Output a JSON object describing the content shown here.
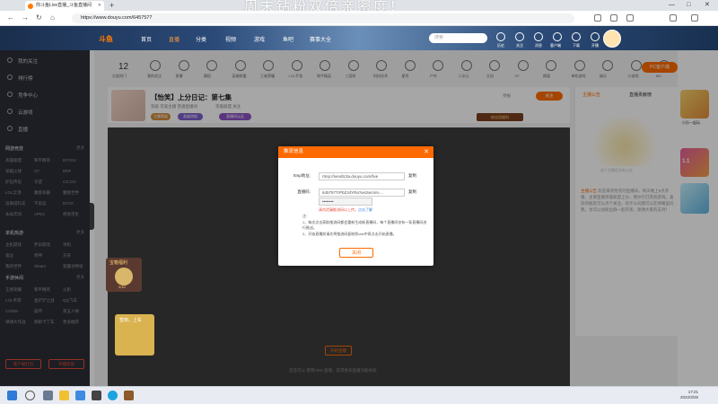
{
  "browser": {
    "tab_title": "你斗鱼Live直播_斗鱼直播间",
    "new_tab": "+",
    "url": "https://www.douyu.com/6457577",
    "banner": "周末钻粉双倍亲密度！",
    "win_controls": [
      "—",
      "□",
      "✕"
    ]
  },
  "header": {
    "logo": "斗鱼",
    "nav": [
      "首页",
      "直播",
      "分类",
      "视频",
      "游戏",
      "鱼吧",
      "赛事大全"
    ],
    "active_nav": "直播",
    "search_placeholder": "搜索",
    "icons": [
      {
        "name": "history-icon",
        "label": "历史"
      },
      {
        "name": "follow-icon",
        "label": "关注"
      },
      {
        "name": "message-icon",
        "label": "消息"
      },
      {
        "name": "upload-icon",
        "label": "客户端"
      },
      {
        "name": "download-icon",
        "label": "下载"
      },
      {
        "name": "broadcast-icon",
        "label": "开播"
      }
    ]
  },
  "sidebar": {
    "main": [
      {
        "label": "我的关注",
        "icon": "heart-icon"
      },
      {
        "label": "排行榜",
        "icon": "rank-icon"
      },
      {
        "label": "竞争中心",
        "icon": "trophy-icon"
      },
      {
        "label": "云游戏",
        "icon": "cloud-icon"
      },
      {
        "label": "直播",
        "icon": "live-icon"
      }
    ],
    "sections": [
      {
        "title": "网游竞技",
        "right": "更多",
        "items": [
          "英雄联盟",
          "和平精英",
          "DOTA2",
          "穿越火线",
          "CF",
          "DNF",
          "炉石传说",
          "守望",
          "CS:GO",
          "LOL云顶",
          "魔兽争霸",
          "魔兽世界",
          "逃离塔科夫",
          "不思议",
          "DOTA",
          "永劫无间",
          "APEX",
          "绝地求生"
        ]
      },
      {
        "title": "单机热游",
        "right": "更多",
        "items": [
          "主机游戏",
          "怀旧游戏",
          "单机",
          "鬼泣",
          "原神",
          "方舟",
          "我的世界",
          "Steam",
          "星露谷物语"
        ]
      },
      {
        "title": "手游休闲",
        "right": "更多",
        "items": [
          "王者荣耀",
          "和平精英",
          "火影",
          "LOL手游",
          "金铲铲之战",
          "QQ飞车",
          "CODM",
          "崩坏",
          "第五人格",
          "球球大作战",
          "跑跑卡丁车",
          "更多推荐"
        ]
      }
    ],
    "bottom_buttons": [
      "客户端打包",
      "开播权限"
    ]
  },
  "categories": {
    "count": "12",
    "count_label": "分类热门",
    "items": [
      "我的关注",
      "直播",
      "舞蹈",
      "英雄联盟",
      "王者荣耀",
      "LOL手游",
      "和平精英",
      "三国杀",
      "科技技术",
      "星秀",
      "户外",
      "二次元",
      "主机",
      "CF",
      "颜值",
      "单机游戏",
      "娱乐",
      "小游戏",
      "MC"
    ],
    "pc_button": "PC客户端"
  },
  "room": {
    "title": "【怡笑】上分日记：第七集",
    "tags_line": "等级  可爱主播  普通直播间",
    "sub_line": "英雄联盟  关注",
    "pills": [
      "主播等级",
      "贵族特权",
      "直播间认证"
    ],
    "follow": "关注",
    "report": "举报",
    "promo": "粉丝团福利",
    "start_button": "开始直播",
    "hint": "您还可以 使用OBS 直播，获得更多直播功能体验"
  },
  "right_panel": {
    "tabs": [
      "主播公告",
      "直播贡献榜"
    ],
    "caption": "这个主播还没有公告",
    "notice_tag": "主播公告",
    "notice": "欢迎来到怡笑的直播间，每天晚上8点开播，主要直播英雄联盟上分，偶尔打打其他游戏。喜欢的朋友可以点个关注，有什么问题可以在弹幕里问我，也可以加粉丝群一起开黑，谢谢大家的支持！"
  },
  "modal": {
    "title": "推流信息",
    "close": "✕",
    "rtmp_label": "rtmp地址:",
    "rtmp_value": "rtmp://sendtc3a.douyu.com/live",
    "key_label": "直播码:",
    "key_value": "6457577rPbZJdYRa?wsSecret=...",
    "copy": "复制",
    "key_masked": "••••••••",
    "warn": "请勿泄漏推流码以上传。",
    "warn_link": "点击了解",
    "notes_title": "注：",
    "notes": [
      "1、每次点击获取推流码都会重新生成新直播码，每个直播间仅有一条直播码进行推送。",
      "2、开始直播前请先将推流码复制到obs中再点击开始直播。"
    ],
    "ok": "关闭"
  },
  "floating": {
    "gift1_title": "宝箱福利",
    "gift1_count": "2/10",
    "gift2_title": "签到，上车",
    "ad1": "小乐一起玩",
    "ad2": "1.1"
  },
  "taskbar": {
    "time": "17:21",
    "date": "2022/3/25"
  }
}
